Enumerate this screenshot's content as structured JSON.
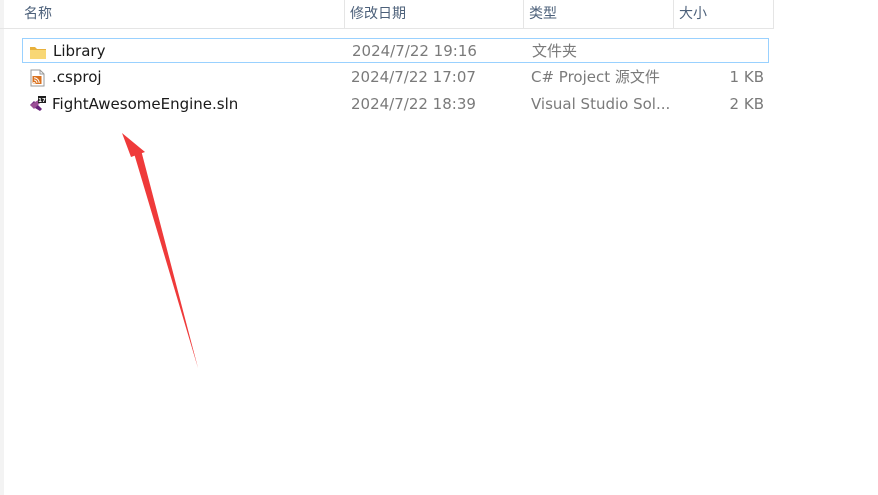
{
  "columns": {
    "name": "名称",
    "modified": "修改日期",
    "type": "类型",
    "size": "大小"
  },
  "files": [
    {
      "name": "Library",
      "modified": "2024/7/22 19:16",
      "type": "文件夹",
      "size": "",
      "icon": "folder-icon"
    },
    {
      "name": ".csproj",
      "modified": "2024/7/22 17:07",
      "type": "C# Project 源文件",
      "size": "1 KB",
      "icon": "csproj-file-icon"
    },
    {
      "name": "FightAwesomeEngine.sln",
      "modified": "2024/7/22 18:39",
      "type": "Visual Studio Sol...",
      "size": "2 KB",
      "icon": "visual-studio-solution-icon"
    }
  ],
  "colors": {
    "header_text": "#4c607a",
    "row_text": "#1a1a1a",
    "detail_text": "#7a7a7a",
    "selection_border": "#99d1ff",
    "annotation_arrow": "#ef3a3a"
  }
}
